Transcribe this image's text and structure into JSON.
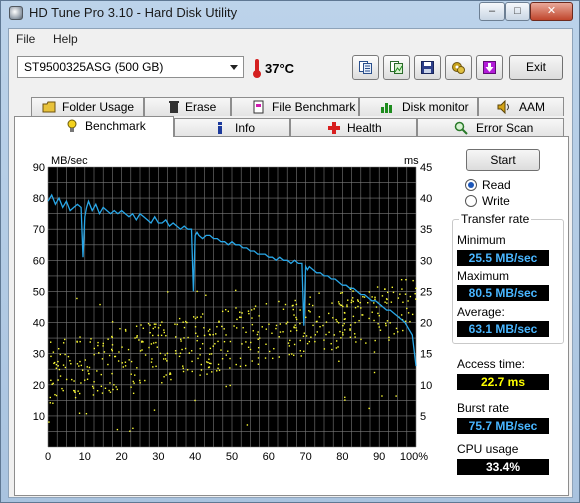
{
  "window": {
    "title": "HD Tune Pro 3.10 - Hard Disk Utility",
    "controls": {
      "minimize": "–",
      "maximize": "□",
      "close": "✕"
    }
  },
  "menu": {
    "file": "File",
    "help": "Help"
  },
  "toolbar": {
    "drive": "ST9500325ASG (500 GB)",
    "temperature": "37°C",
    "buttons": [
      "copy-text-icon",
      "copy-screenshot-icon",
      "save-icon",
      "options-icon",
      "download-icon"
    ],
    "exit_label": "Exit"
  },
  "tabs": {
    "row1": [
      "Folder Usage",
      "Erase",
      "File Benchmark",
      "Disk monitor",
      "AAM"
    ],
    "row2": [
      "Benchmark",
      "Info",
      "Health",
      "Error Scan"
    ],
    "active": "Benchmark"
  },
  "benchmark": {
    "start_label": "Start",
    "mode_read": "Read",
    "mode_write": "Write",
    "selected_mode": "Read",
    "transfer_rate_title": "Transfer rate",
    "minimum_label": "Minimum",
    "minimum_value": "25.5 MB/sec",
    "maximum_label": "Maximum",
    "maximum_value": "80.5 MB/sec",
    "average_label": "Average:",
    "average_value": "63.1 MB/sec",
    "access_time_label": "Access time:",
    "access_time_value": "22.7 ms",
    "burst_rate_label": "Burst rate",
    "burst_rate_value": "75.7 MB/sec",
    "cpu_usage_label": "CPU usage",
    "cpu_usage_value": "33.4%"
  },
  "colors": {
    "plot_bg": "#000000",
    "grid": "#7a7a7a",
    "transfer_line": "#29a7e8",
    "access_dots": "#ffff33"
  },
  "chart_data": {
    "type": "line",
    "ylabel_left": "MB/sec",
    "ylabel_right": "ms",
    "y_left_ticks": [
      "90",
      "80",
      "70",
      "60",
      "50",
      "40",
      "30",
      "20",
      "10"
    ],
    "y_right_ticks": [
      "45",
      "40",
      "35",
      "30",
      "25",
      "20",
      "15",
      "10",
      "5"
    ],
    "x_ticks": [
      "0",
      "10",
      "20",
      "30",
      "40",
      "50",
      "60",
      "70",
      "80",
      "90",
      "100%"
    ],
    "ylim_left": [
      0,
      90
    ],
    "ylim_right": [
      0,
      45
    ],
    "xlim": [
      0,
      100
    ],
    "grid": true,
    "series": [
      {
        "axis": "left",
        "x": [
          0,
          1,
          2,
          3,
          4,
          5,
          6,
          7,
          8,
          9,
          9.5,
          10,
          10.5,
          11,
          12,
          13,
          14,
          15,
          16,
          17,
          18,
          19,
          20,
          21,
          22,
          23,
          24,
          25,
          26,
          27,
          28,
          29,
          30,
          31,
          32,
          33,
          34,
          35,
          36,
          37,
          38,
          39,
          39.5,
          40,
          40.5,
          41,
          42,
          43,
          44,
          45,
          46,
          47,
          48,
          49,
          50,
          51,
          52,
          53,
          54,
          55,
          56,
          57,
          58,
          59,
          60,
          61,
          62,
          63,
          64,
          65,
          66,
          67,
          68,
          69,
          69.5,
          70,
          70.5,
          71,
          72,
          73,
          74,
          75,
          76,
          77,
          78,
          79,
          80,
          81,
          82,
          83,
          84,
          85,
          86,
          87,
          88,
          89,
          90,
          91,
          92,
          93,
          94,
          95,
          96,
          97,
          98,
          99,
          100
        ],
        "y": [
          79,
          81,
          78,
          80,
          77,
          79,
          76,
          77,
          78,
          77,
          61,
          74,
          77,
          79,
          76,
          78,
          75,
          77,
          76,
          75,
          76,
          75,
          76,
          75,
          74,
          75,
          73,
          75,
          74,
          73,
          72,
          74,
          72,
          72,
          73,
          71,
          72,
          71,
          70,
          71,
          70,
          70,
          50,
          68,
          69,
          68,
          67,
          68,
          68,
          67,
          67,
          66,
          66,
          65,
          66,
          65,
          65,
          64,
          64,
          63,
          63,
          62,
          62,
          62,
          61,
          61,
          60,
          61,
          60,
          60,
          59,
          60,
          59,
          59,
          39,
          58,
          57,
          58,
          57,
          56,
          56,
          55,
          55,
          54,
          54,
          53,
          52,
          52,
          51,
          51,
          50,
          49,
          49,
          48,
          47,
          47,
          46,
          45,
          44,
          44,
          43,
          42,
          41,
          40,
          38,
          36,
          26
        ]
      }
    ],
    "access_time_scatter": {
      "axis": "right",
      "approx_range_ms": [
        5,
        27
      ],
      "trend": "increases with position from ~12 ms at 0% to ~23 ms at 100%"
    }
  }
}
